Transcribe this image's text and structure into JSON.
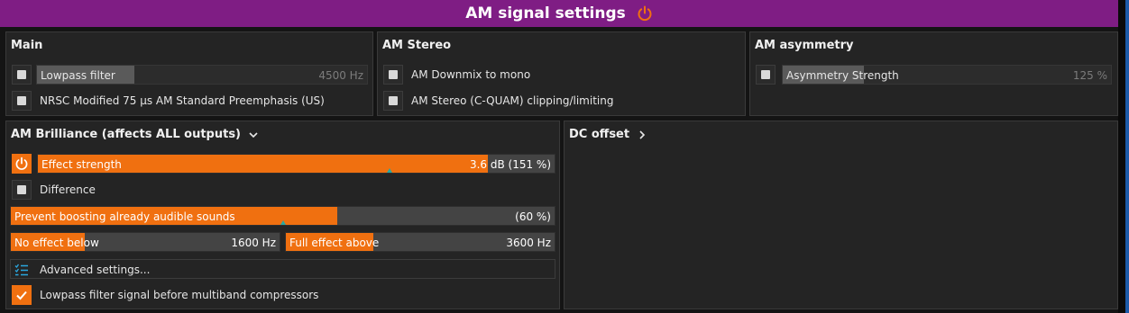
{
  "window": {
    "title": "AM signal settings",
    "power_icon": "power-icon"
  },
  "colors": {
    "titlebar": "#7f1d84",
    "accent": "#f07010",
    "panel": "#242424",
    "marker": "#2aa8a0"
  },
  "main": {
    "title": "Main",
    "lowpass": {
      "label": "Lowpass filter",
      "value": "4500 Hz",
      "checked": false
    },
    "nrsc": {
      "label": "NRSC Modified 75 µs AM Standard Preemphasis (US)",
      "checked": false
    }
  },
  "am_stereo": {
    "title": "AM Stereo",
    "downmix": {
      "label": "AM Downmix to mono",
      "checked": false
    },
    "cquam": {
      "label": "AM Stereo (C-QUAM) clipping/limiting",
      "checked": false
    }
  },
  "am_asymmetry": {
    "title": "AM asymmetry",
    "strength": {
      "label": "Asymmetry Strength",
      "value": "125 %",
      "checked": false
    }
  },
  "brilliance": {
    "title": "AM Brilliance (affects ALL outputs)",
    "effect_strength": {
      "label": "Effect strength",
      "value": "3.6 dB (151 %)",
      "level": 0.87,
      "marker": 0.68
    },
    "difference": {
      "label": "Difference",
      "checked": false
    },
    "prevent_boosting": {
      "label": "Prevent boosting already audible sounds",
      "value": "(60 %)",
      "level": 0.6,
      "marker": 0.5
    },
    "no_effect_below": {
      "label": "No effect below",
      "value": "1600 Hz"
    },
    "full_effect_above": {
      "label": "Full effect above",
      "value": "3600 Hz"
    },
    "advanced": {
      "label": "Advanced settings..."
    },
    "lowpass_multiband": {
      "label": "Lowpass filter signal before multiband compressors",
      "checked": true
    }
  },
  "dc_offset": {
    "title": "DC offset"
  }
}
